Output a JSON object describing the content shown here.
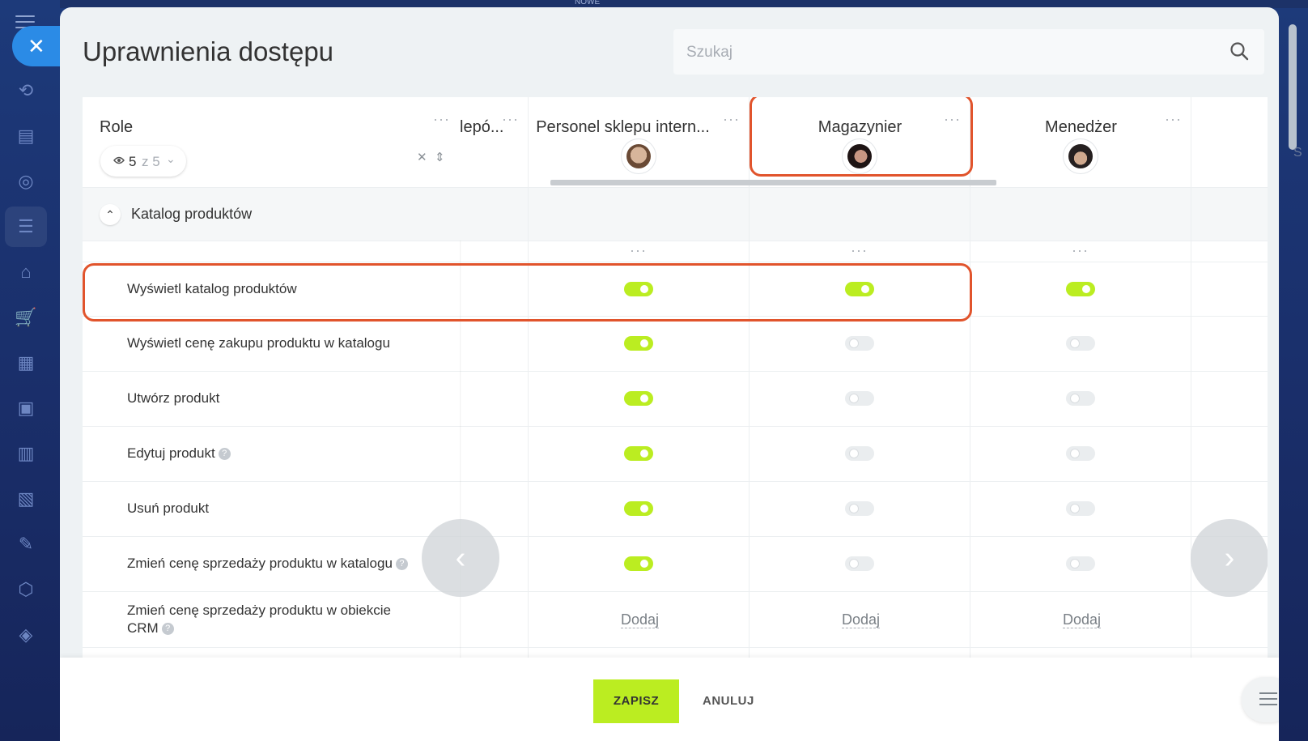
{
  "behind": {
    "tag": "NOWE",
    "edge_letter": "S"
  },
  "page": {
    "title": "Uprawnienia dostępu"
  },
  "search": {
    "placeholder": "Szukaj"
  },
  "roles_header": {
    "label": "Role",
    "visible_count": "5",
    "total": "z 5"
  },
  "columns": [
    {
      "name": "lepó...",
      "partial": true
    },
    {
      "name": "Personel sklepu intern..."
    },
    {
      "name": "Magazynier",
      "highlighted": true
    },
    {
      "name": "Menedżer"
    }
  ],
  "section": {
    "label": "Katalog produktów"
  },
  "rows": [
    {
      "label": "Wyświetl katalog produktów",
      "help": false,
      "values": [
        true,
        true,
        true
      ],
      "highlighted": true
    },
    {
      "label": "Wyświetl cenę zakupu produktu w katalogu",
      "help": false,
      "values": [
        true,
        false,
        false
      ]
    },
    {
      "label": "Utwórz produkt",
      "help": false,
      "values": [
        true,
        false,
        false
      ]
    },
    {
      "label": "Edytuj produkt",
      "help": true,
      "values": [
        true,
        false,
        false
      ]
    },
    {
      "label": "Usuń produkt",
      "help": false,
      "values": [
        true,
        false,
        false
      ]
    },
    {
      "label": "Zmień cenę sprzedaży produktu w katalogu",
      "help": true,
      "values": [
        true,
        false,
        false
      ]
    },
    {
      "label_line1": "Zmień cenę sprzedaży produktu w obiekcie",
      "label_line2": "CRM",
      "help": true,
      "add_label": "Dodaj"
    }
  ],
  "footer": {
    "save": "ZAPISZ",
    "cancel": "ANULUJ"
  },
  "colors": {
    "accent_green": "#bbed21",
    "highlight": "#e1542c",
    "close_blue": "#2b8be6"
  }
}
